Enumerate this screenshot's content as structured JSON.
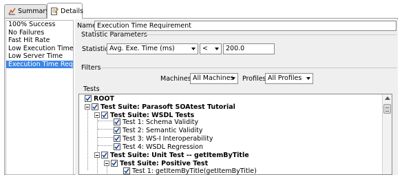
{
  "tabs": [
    {
      "label": "Summary",
      "icon": "summary-chart-icon"
    },
    {
      "label": "Details",
      "icon": "details-edit-icon",
      "selected": true
    }
  ],
  "left_list": {
    "items": [
      "100% Success",
      "No Failures",
      "Fast Hit Rate",
      "Low Execution Time",
      "Low Server Time",
      "Execution Time Requirement"
    ],
    "selected_index": 5
  },
  "name": {
    "label": "Name",
    "value": "Execution Time Requirement"
  },
  "statistic_parameters": {
    "title": "Statistic Parameters",
    "statistic_label": "Statistic",
    "statistic_value": "Avg. Exe. Time (ms)",
    "operator_value": "<",
    "threshold_value": "200.0"
  },
  "filters": {
    "title": "Filters",
    "machines_label": "Machines",
    "machines_value": "All Machines",
    "profiles_label": "Profiles",
    "profiles_value": "All Profiles"
  },
  "tests": {
    "title": "Tests",
    "tree": [
      {
        "label": "ROOT",
        "bold": true,
        "checked": true
      },
      {
        "label": "Test Suite: Parasoft SOAtest Tutorial",
        "bold": true,
        "checked": true
      },
      {
        "label": "Test Suite: WSDL Tests",
        "bold": true,
        "checked": true
      },
      {
        "label": "Test 1: Schema Validity",
        "bold": false,
        "checked": true
      },
      {
        "label": "Test 2: Semantic Validity",
        "bold": false,
        "checked": true
      },
      {
        "label": "Test 3: WS-I Interoperability",
        "bold": false,
        "checked": true
      },
      {
        "label": "Test 4: WSDL Regression",
        "bold": false,
        "checked": true
      },
      {
        "label": "Test Suite: Unit Test -- getItemByTitle",
        "bold": true,
        "checked": true
      },
      {
        "label": "Test Suite: Positive Test",
        "bold": true,
        "checked": true
      },
      {
        "label": "Test 1: getItemByTitle(getItemByTitle)",
        "bold": false,
        "checked": true
      }
    ]
  }
}
